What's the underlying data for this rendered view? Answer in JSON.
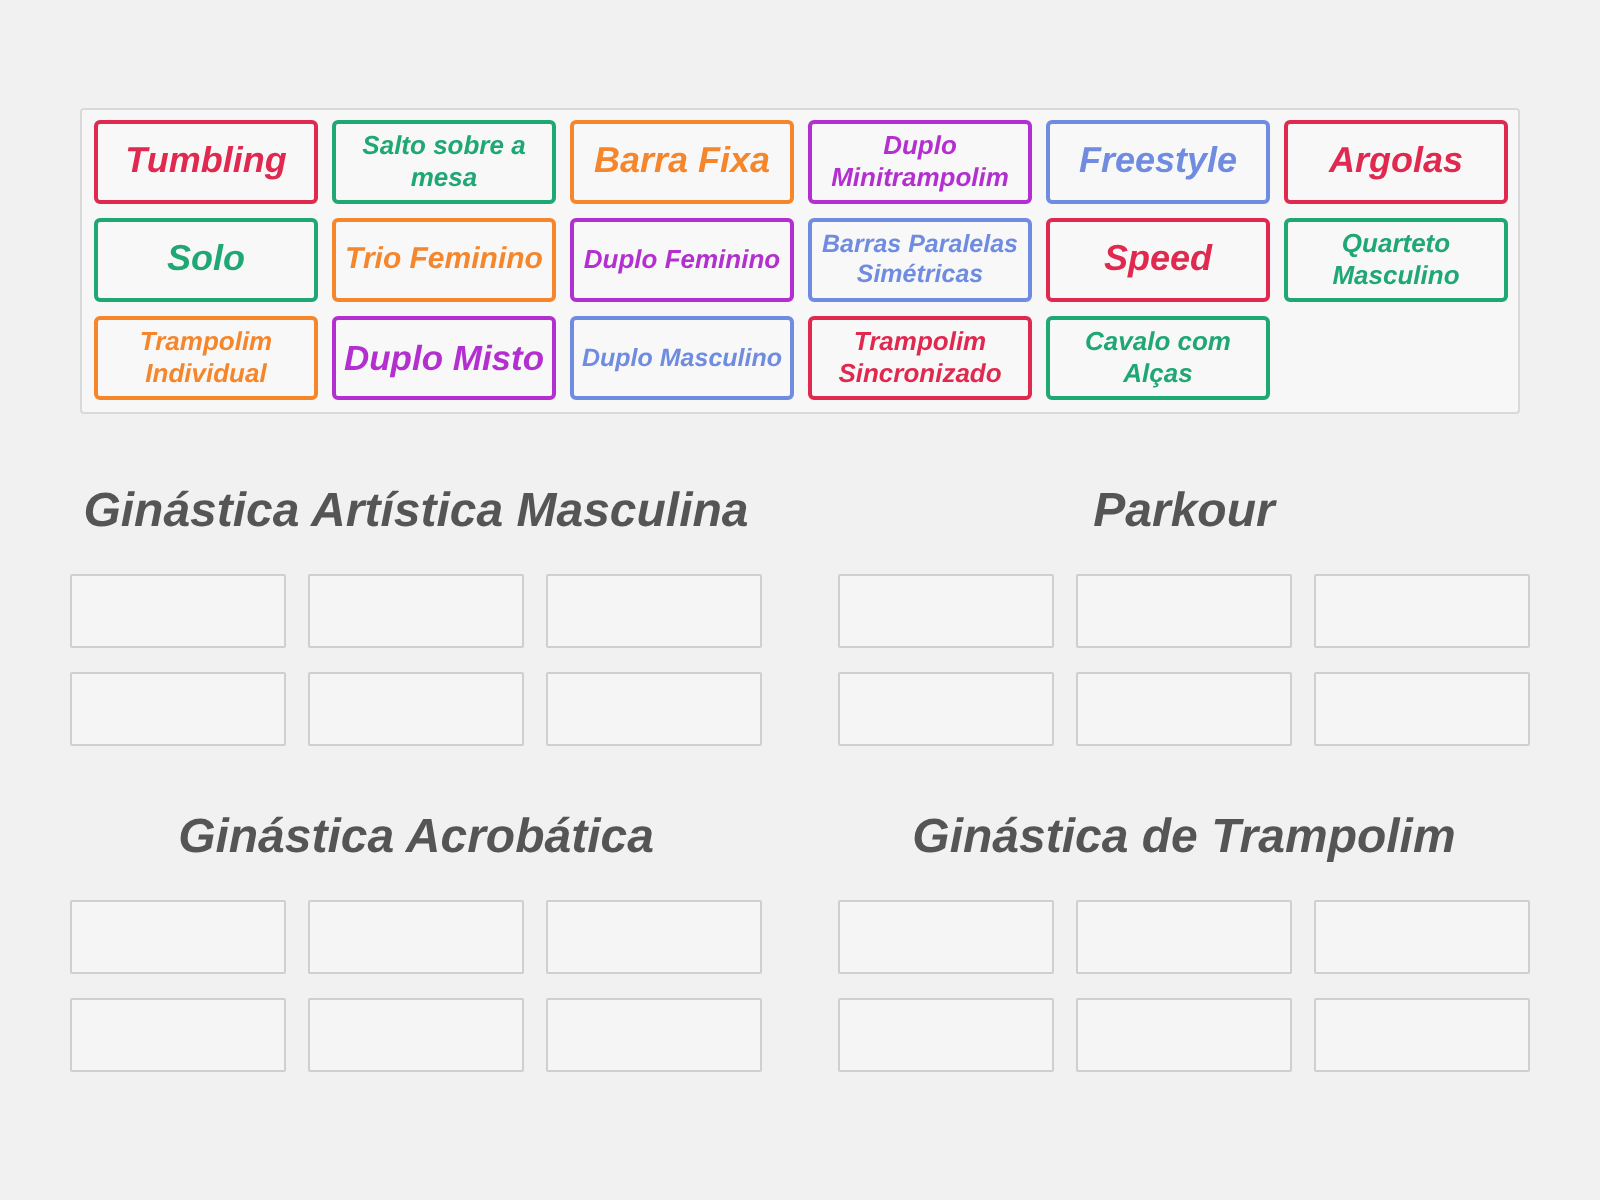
{
  "tiles": [
    {
      "text": "Tumbling",
      "color": "#e0294f"
    },
    {
      "text": "Salto sobre a mesa",
      "color": "#1fa774"
    },
    {
      "text": "Barra Fixa",
      "color": "#f5862c"
    },
    {
      "text": "Duplo Minitrampolim",
      "color": "#b32fcf"
    },
    {
      "text": "Freestyle",
      "color": "#6f8ce0"
    },
    {
      "text": "Argolas",
      "color": "#e0294f"
    },
    {
      "text": "Solo",
      "color": "#1fa774"
    },
    {
      "text": "Trio Feminino",
      "color": "#f5862c"
    },
    {
      "text": "Duplo Feminino",
      "color": "#b32fcf"
    },
    {
      "text": "Barras Paralelas Simétricas",
      "color": "#6f8ce0"
    },
    {
      "text": "Speed",
      "color": "#e0294f"
    },
    {
      "text": "Quarteto Masculino",
      "color": "#1fa774"
    },
    {
      "text": "Trampolim Individual",
      "color": "#f5862c"
    },
    {
      "text": "Duplo Misto",
      "color": "#b32fcf"
    },
    {
      "text": "Duplo Masculino",
      "color": "#6f8ce0"
    },
    {
      "text": "Trampolim Sincronizado",
      "color": "#e0294f"
    },
    {
      "text": "Cavalo com Alças",
      "color": "#1fa774"
    }
  ],
  "groups": [
    {
      "title": "Ginástica Artística Masculina"
    },
    {
      "title": "Parkour"
    },
    {
      "title": "Ginástica Acrobática"
    },
    {
      "title": "Ginástica de Trampolim"
    }
  ]
}
